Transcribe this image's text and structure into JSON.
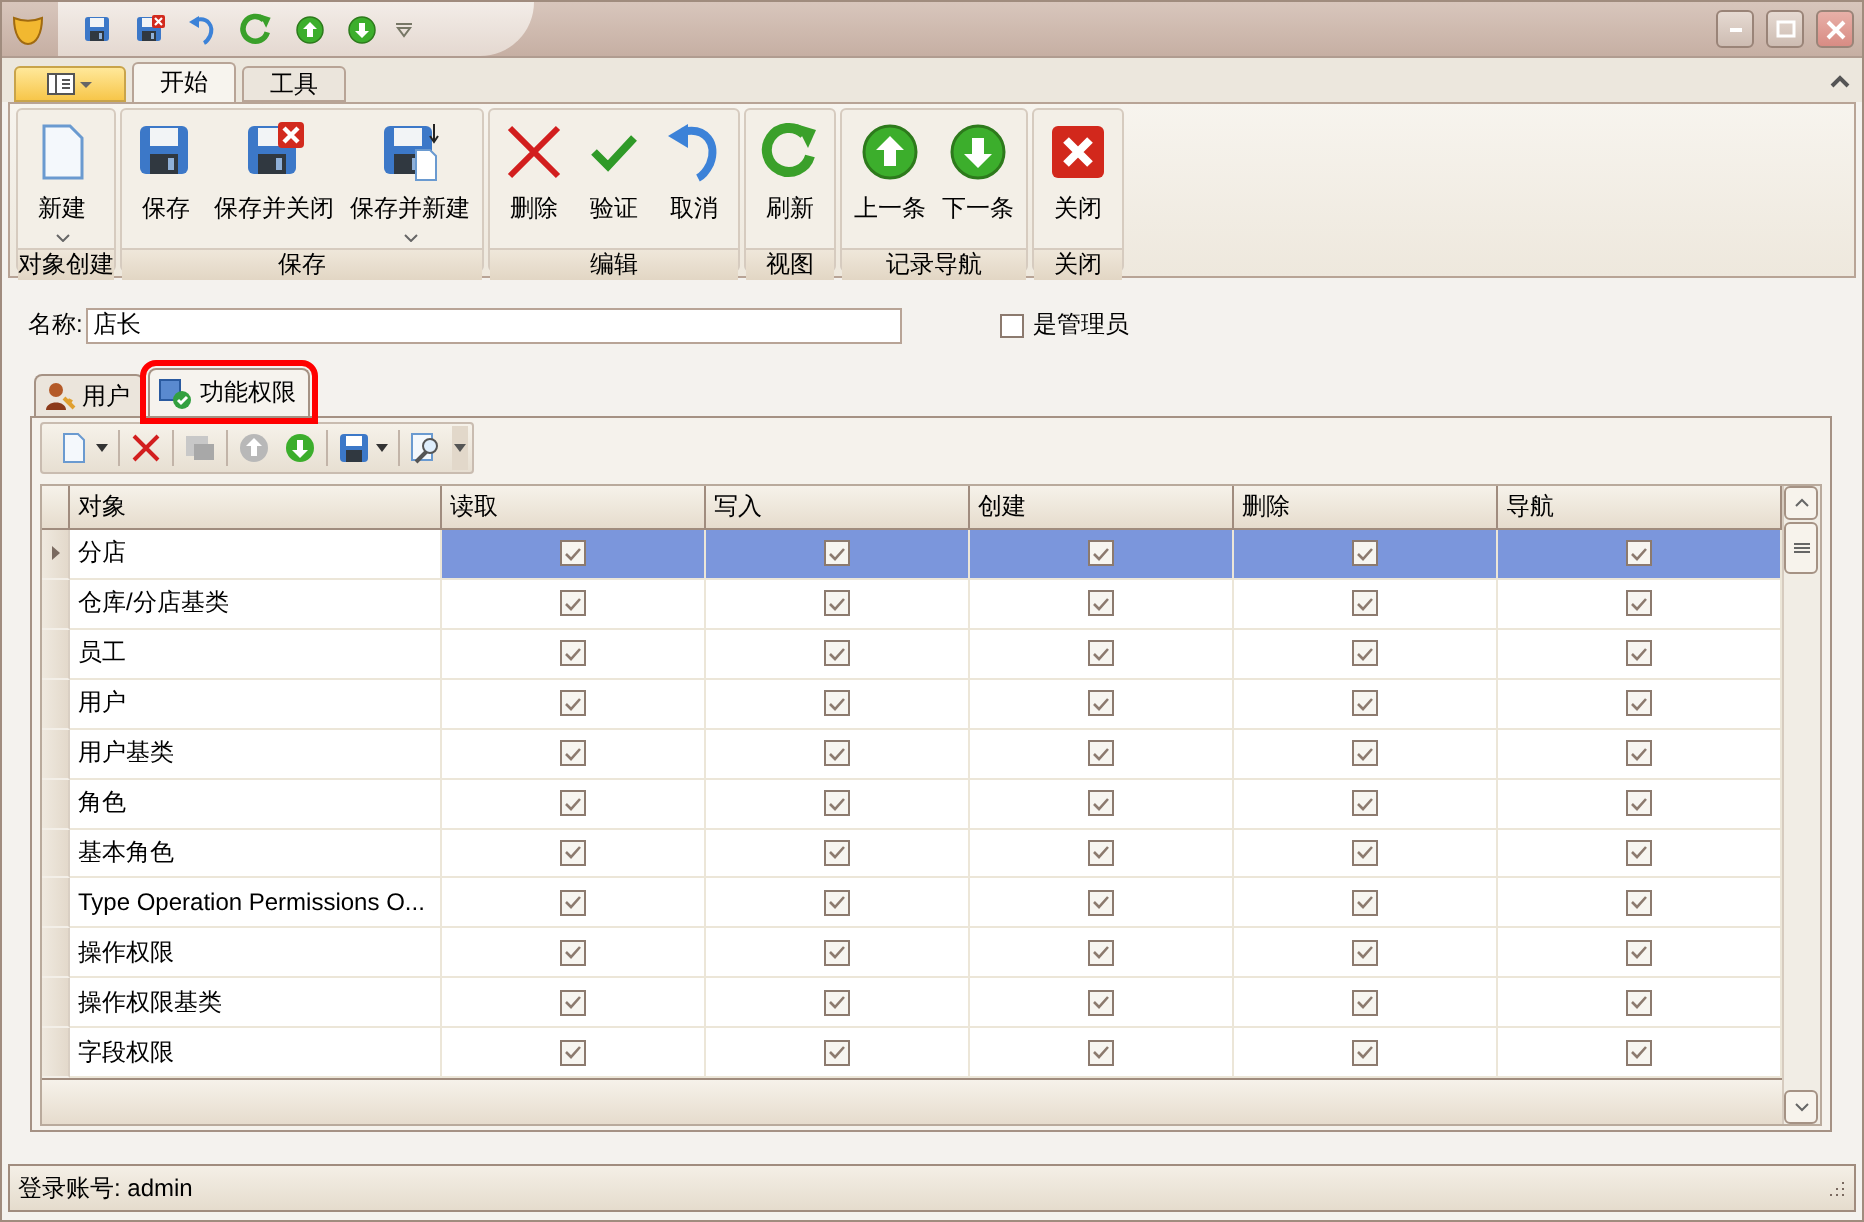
{
  "ribbon": {
    "tabs": [
      {
        "label": "开始",
        "selected": true
      },
      {
        "label": "工具",
        "selected": false
      }
    ],
    "groups": [
      {
        "label": "对象创建",
        "buttons": [
          {
            "kind": "new",
            "label": "新建",
            "dropdown": true
          }
        ]
      },
      {
        "label": "保存",
        "buttons": [
          {
            "kind": "save",
            "label": "保存",
            "dropdown": false
          },
          {
            "kind": "saveclose",
            "label": "保存并关闭",
            "dropdown": false
          },
          {
            "kind": "savenew",
            "label": "保存并新建",
            "dropdown": true
          }
        ]
      },
      {
        "label": "编辑",
        "buttons": [
          {
            "kind": "delete",
            "label": "删除",
            "dropdown": false
          },
          {
            "kind": "validate",
            "label": "验证",
            "dropdown": false
          },
          {
            "kind": "undo",
            "label": "取消",
            "dropdown": false
          }
        ]
      },
      {
        "label": "视图",
        "buttons": [
          {
            "kind": "refresh",
            "label": "刷新",
            "dropdown": false
          }
        ]
      },
      {
        "label": "记录导航",
        "buttons": [
          {
            "kind": "up",
            "label": "上一条",
            "dropdown": false
          },
          {
            "kind": "down",
            "label": "下一条",
            "dropdown": false
          }
        ]
      },
      {
        "label": "关闭",
        "buttons": [
          {
            "kind": "close",
            "label": "关闭",
            "dropdown": false
          }
        ]
      }
    ]
  },
  "form": {
    "name": {
      "label": "名称:",
      "value": "店长"
    },
    "admin": {
      "label": "是管理员",
      "checked": false
    }
  },
  "detail_tabs": [
    {
      "kind": "user",
      "label": "用户",
      "selected": false,
      "highlighted": false
    },
    {
      "kind": "permission",
      "label": "功能权限",
      "selected": true,
      "highlighted": true
    }
  ],
  "grid": {
    "columns": [
      "对象",
      "读取",
      "写入",
      "创建",
      "删除",
      "导航"
    ],
    "rows": [
      {
        "object": "分店",
        "selected": true,
        "checks": [
          true,
          true,
          true,
          true,
          true
        ]
      },
      {
        "object": "仓库/分店基类",
        "selected": false,
        "checks": [
          true,
          true,
          true,
          true,
          true
        ]
      },
      {
        "object": "员工",
        "selected": false,
        "checks": [
          true,
          true,
          true,
          true,
          true
        ]
      },
      {
        "object": "用户",
        "selected": false,
        "checks": [
          true,
          true,
          true,
          true,
          true
        ]
      },
      {
        "object": "用户基类",
        "selected": false,
        "checks": [
          true,
          true,
          true,
          true,
          true
        ]
      },
      {
        "object": "角色",
        "selected": false,
        "checks": [
          true,
          true,
          true,
          true,
          true
        ]
      },
      {
        "object": "基本角色",
        "selected": false,
        "checks": [
          true,
          true,
          true,
          true,
          true
        ]
      },
      {
        "object": "Type Operation Permissions O...",
        "selected": false,
        "checks": [
          true,
          true,
          true,
          true,
          true
        ]
      },
      {
        "object": "操作权限",
        "selected": false,
        "checks": [
          true,
          true,
          true,
          true,
          true
        ]
      },
      {
        "object": "操作权限基类",
        "selected": false,
        "checks": [
          true,
          true,
          true,
          true,
          true
        ]
      },
      {
        "object": "字段权限",
        "selected": false,
        "checks": [
          true,
          true,
          true,
          true,
          true
        ]
      }
    ]
  },
  "status_bar": {
    "text": "登录账号: admin"
  }
}
